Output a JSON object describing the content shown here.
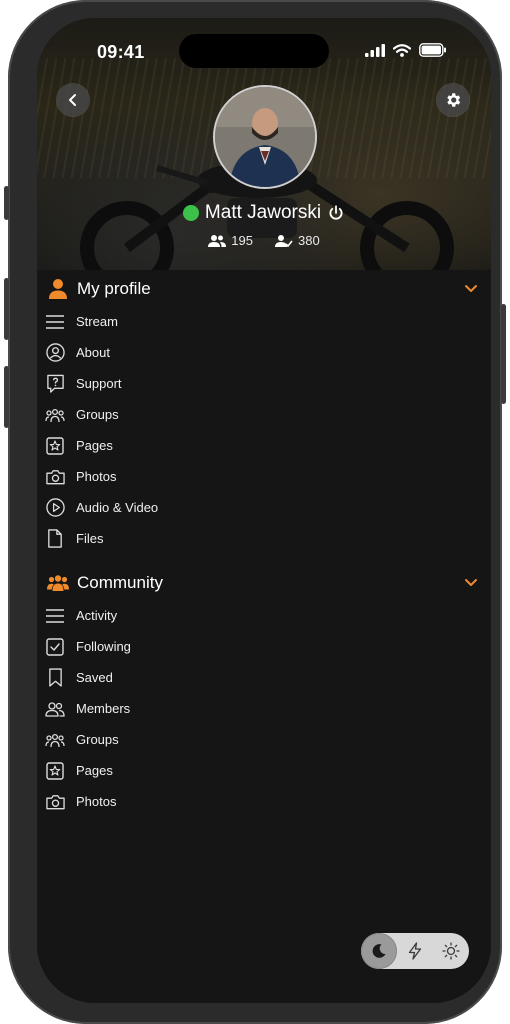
{
  "status_bar": {
    "time": "09:41"
  },
  "profile": {
    "name": "Matt Jaworski",
    "friends_count": "195",
    "followers_count": "380",
    "online_color": "#3cc14b"
  },
  "accent_color": "#f08a2b",
  "sections": {
    "my_profile": {
      "title": "My profile",
      "items": [
        {
          "label": "Stream",
          "icon": "list-icon"
        },
        {
          "label": "About",
          "icon": "user-circle-icon"
        },
        {
          "label": "Support",
          "icon": "question-bubble-icon"
        },
        {
          "label": "Groups",
          "icon": "group-icon"
        },
        {
          "label": "Pages",
          "icon": "star-page-icon"
        },
        {
          "label": "Photos",
          "icon": "camera-icon"
        },
        {
          "label": "Audio & Video",
          "icon": "play-icon"
        },
        {
          "label": "Files",
          "icon": "file-icon"
        }
      ]
    },
    "community": {
      "title": "Community",
      "items": [
        {
          "label": "Activity",
          "icon": "list-icon"
        },
        {
          "label": "Following",
          "icon": "check-square-icon"
        },
        {
          "label": "Saved",
          "icon": "bookmark-icon"
        },
        {
          "label": "Members",
          "icon": "members-icon"
        },
        {
          "label": "Groups",
          "icon": "group-icon"
        },
        {
          "label": "Pages",
          "icon": "star-page-icon"
        },
        {
          "label": "Photos",
          "icon": "camera-icon"
        }
      ]
    }
  },
  "theme_toggle": {
    "options": [
      "dark",
      "auto",
      "light"
    ],
    "selected": "dark"
  }
}
